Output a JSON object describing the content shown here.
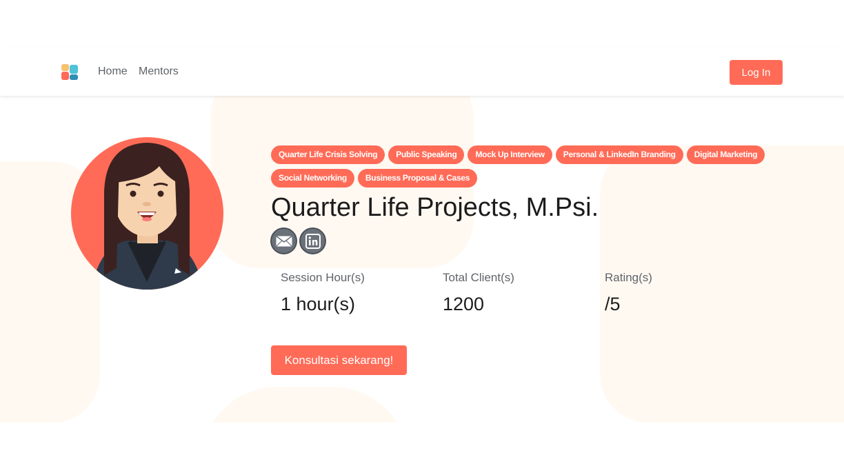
{
  "nav": {
    "logo_icon": "app-logo-icon",
    "links": [
      "Home",
      "Mentors"
    ],
    "login_label": "Log In"
  },
  "profile": {
    "avatar_icon": "mentor-avatar-illustration",
    "tags": [
      "Quarter Life Crisis Solving",
      "Public Speaking",
      "Mock Up Interview",
      "Personal & LinkedIn Branding",
      "Digital Marketing",
      "Social Networking",
      "Business Proposal & Cases"
    ],
    "name": "Quarter Life Projects, M.Psi.",
    "social": [
      "email-icon",
      "linkedin-icon"
    ],
    "stats": [
      {
        "label": "Session Hour(s)",
        "value": "1 hour(s)"
      },
      {
        "label": "Total Client(s)",
        "value": "1200"
      },
      {
        "label": "Rating(s)",
        "value": "/5"
      }
    ],
    "cta_label": "Konsultasi sekarang!"
  },
  "colors": {
    "accent": "#ff6b57",
    "background_shape": "#fff9f2",
    "social_icon_bg": "#6b7179"
  }
}
